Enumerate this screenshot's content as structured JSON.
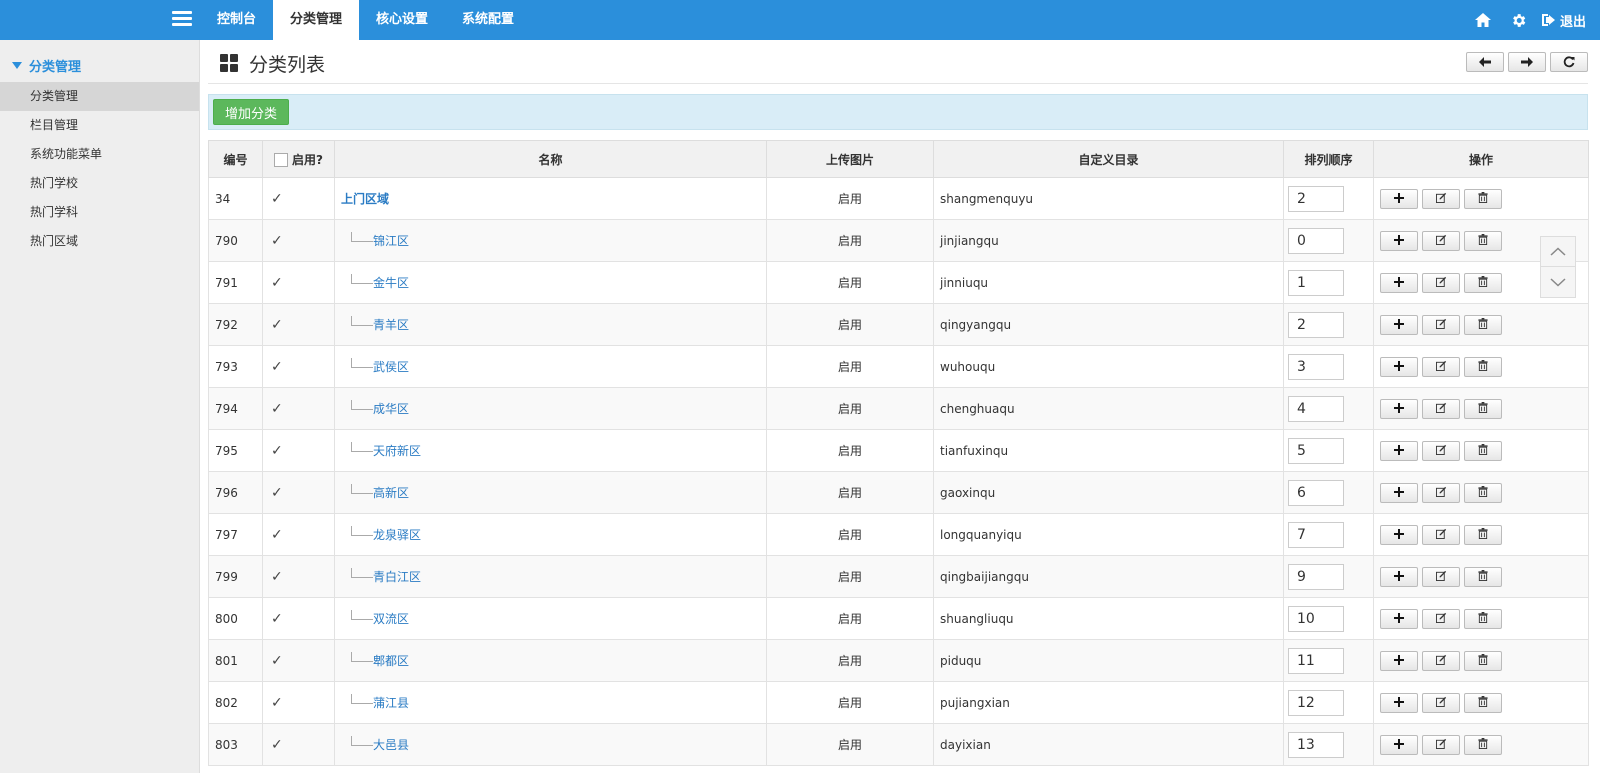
{
  "nav": {
    "items": [
      {
        "label": "控制台",
        "active": false
      },
      {
        "label": "分类管理",
        "active": true
      },
      {
        "label": "核心设置",
        "active": false
      },
      {
        "label": "系统配置",
        "active": false
      }
    ],
    "logout_label": "退出",
    "icons": [
      "home-icon",
      "gear-icon",
      "logout-icon"
    ]
  },
  "sidebar": {
    "group_label": "分类管理",
    "items": [
      {
        "label": "分类管理",
        "active": true
      },
      {
        "label": "栏目管理",
        "active": false
      },
      {
        "label": "系统功能菜单",
        "active": false
      },
      {
        "label": "热门学校",
        "active": false
      },
      {
        "label": "热门学科",
        "active": false
      },
      {
        "label": "热门区域",
        "active": false
      }
    ]
  },
  "page": {
    "title": "分类列表",
    "add_button": "增加分类"
  },
  "table": {
    "headers": [
      "编号",
      "启用?",
      "名称",
      "上传图片",
      "自定义目录",
      "排列顺序",
      "操作"
    ],
    "rows": [
      {
        "id": "34",
        "name": "上门区域",
        "level": 0,
        "image": "启用",
        "dir": "shangmenquyu",
        "order": "2"
      },
      {
        "id": "790",
        "name": "锦江区",
        "level": 1,
        "image": "启用",
        "dir": "jinjiangqu",
        "order": "0"
      },
      {
        "id": "791",
        "name": "金牛区",
        "level": 1,
        "image": "启用",
        "dir": "jinniuqu",
        "order": "1"
      },
      {
        "id": "792",
        "name": "青羊区",
        "level": 1,
        "image": "启用",
        "dir": "qingyangqu",
        "order": "2"
      },
      {
        "id": "793",
        "name": "武侯区",
        "level": 1,
        "image": "启用",
        "dir": "wuhouqu",
        "order": "3"
      },
      {
        "id": "794",
        "name": "成华区",
        "level": 1,
        "image": "启用",
        "dir": "chenghuaqu",
        "order": "4"
      },
      {
        "id": "795",
        "name": "天府新区",
        "level": 1,
        "image": "启用",
        "dir": "tianfuxinqu",
        "order": "5"
      },
      {
        "id": "796",
        "name": "高新区",
        "level": 1,
        "image": "启用",
        "dir": "gaoxinqu",
        "order": "6"
      },
      {
        "id": "797",
        "name": "龙泉驿区",
        "level": 1,
        "image": "启用",
        "dir": "longquanyiqu",
        "order": "7"
      },
      {
        "id": "799",
        "name": "青白江区",
        "level": 1,
        "image": "启用",
        "dir": "qingbaijiangqu",
        "order": "9"
      },
      {
        "id": "800",
        "name": "双流区",
        "level": 1,
        "image": "启用",
        "dir": "shuangliuqu",
        "order": "10"
      },
      {
        "id": "801",
        "name": "郫都区",
        "level": 1,
        "image": "启用",
        "dir": "piduqu",
        "order": "11"
      },
      {
        "id": "802",
        "name": "蒲江县",
        "level": 1,
        "image": "启用",
        "dir": "pujiangxian",
        "order": "12"
      },
      {
        "id": "803",
        "name": "大邑县",
        "level": 1,
        "image": "启用",
        "dir": "dayixian",
        "order": "13"
      }
    ]
  },
  "colors": {
    "primary": "#2b8fdb",
    "add_button": "#5cb85c",
    "toolbar_bg": "#d9edf7",
    "link": "#2b7cc4"
  }
}
